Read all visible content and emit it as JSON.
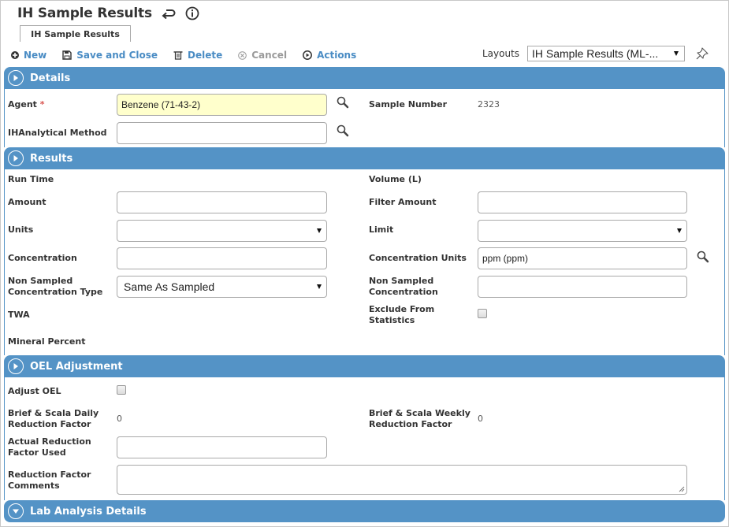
{
  "header": {
    "title": "IH Sample Results",
    "icons": [
      "return-icon",
      "info-icon"
    ]
  },
  "tabs": [
    {
      "label": "IH Sample Results",
      "active": true
    }
  ],
  "toolbar": {
    "new_label": "New",
    "save_close_label": "Save and Close",
    "delete_label": "Delete",
    "cancel_label": "Cancel",
    "actions_label": "Actions",
    "layouts_label": "Layouts",
    "layouts_value": "IH Sample Results (ML-..."
  },
  "colors": {
    "accent": "#5493c6",
    "link": "#4a8cc4",
    "highlight_field": "#ffffcc",
    "required": "#d9534f"
  },
  "sections": {
    "details": {
      "title": "Details",
      "agent_label": "Agent",
      "agent_required": "*",
      "agent_value": "Benzene (71-43-2)",
      "sample_number_label": "Sample Number",
      "sample_number_value": "2323",
      "method_label": "IHAnalytical Method",
      "method_value": ""
    },
    "results": {
      "title": "Results",
      "run_time_label": "Run Time",
      "volume_label": "Volume (L)",
      "amount_label": "Amount",
      "amount_value": "",
      "filter_amount_label": "Filter Amount",
      "filter_amount_value": "",
      "units_label": "Units",
      "units_value": "",
      "limit_label": "Limit",
      "limit_value": "",
      "concentration_label": "Concentration",
      "concentration_value": "",
      "conc_units_label": "Concentration Units",
      "conc_units_value": "ppm (ppm)",
      "ns_conc_type_label_1": "Non Sampled",
      "ns_conc_type_label_2": "Concentration Type",
      "ns_conc_type_value": "Same As Sampled",
      "ns_conc_label_1": "Non Sampled",
      "ns_conc_label_2": "Concentration",
      "ns_conc_value": "",
      "twa_label": "TWA",
      "exclude_label_1": "Exclude From",
      "exclude_label_2": "Statistics",
      "exclude_checked": false,
      "mineral_label": "Mineral Percent"
    },
    "oel": {
      "title": "OEL Adjustment",
      "adjust_label": "Adjust OEL",
      "adjust_checked": false,
      "daily_label_1": "Brief & Scala Daily",
      "daily_label_2": "Reduction Factor",
      "daily_value": "0",
      "weekly_label_1": "Brief & Scala Weekly",
      "weekly_label_2": "Reduction Factor",
      "weekly_value": "0",
      "actual_label_1": "Actual Reduction",
      "actual_label_2": "Factor Used",
      "actual_value": "",
      "comments_label_1": "Reduction Factor",
      "comments_label_2": "Comments",
      "comments_value": ""
    },
    "lab": {
      "title": "Lab Analysis Details",
      "expanded": false
    }
  }
}
